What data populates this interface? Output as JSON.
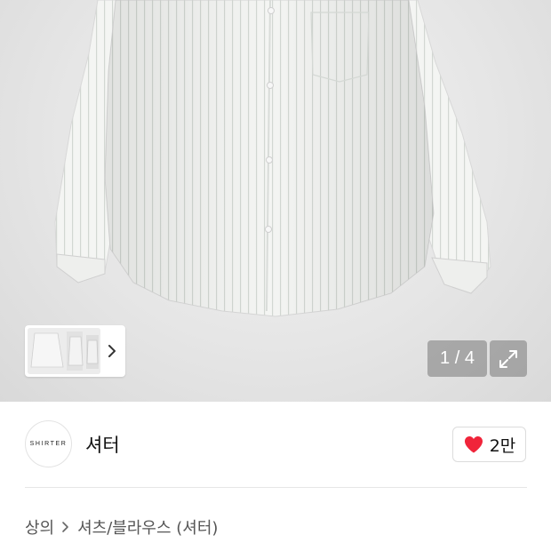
{
  "gallery": {
    "image_alt": "white striped long-sleeve shirt",
    "counter": "1 / 4",
    "icons": {
      "next": "chevron-right-icon",
      "expand": "expand-icon"
    }
  },
  "brand": {
    "logo_text": "SHIRTER",
    "name": "셔터"
  },
  "like": {
    "count": "2만",
    "icon": "heart-icon",
    "color": "#f0243a"
  },
  "breadcrumb": {
    "items": [
      "상의",
      "셔츠/블라우스 (셔터)"
    ],
    "separator_icon": "chevron-right-icon"
  }
}
